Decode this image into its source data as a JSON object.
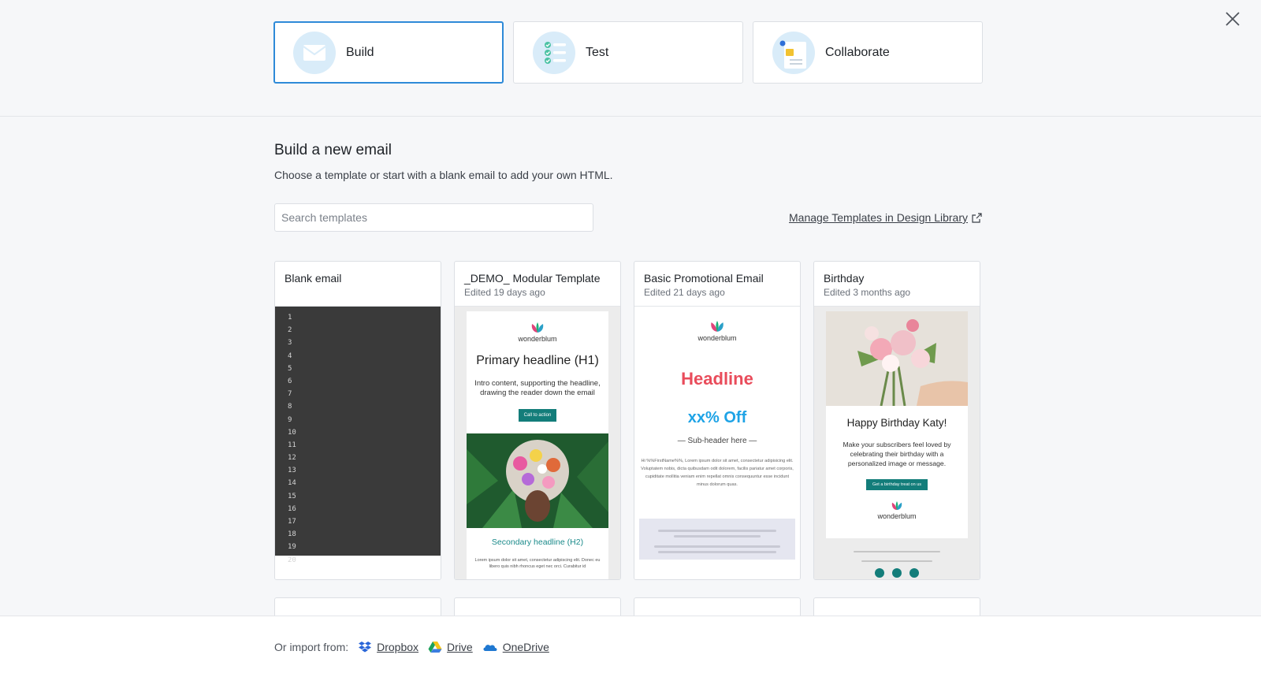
{
  "modes": [
    {
      "label": "Build",
      "icon": "envelope-icon"
    },
    {
      "label": "Test",
      "icon": "checklist-icon"
    },
    {
      "label": "Collaborate",
      "icon": "thumbs-up-note-icon"
    }
  ],
  "colors": {
    "accent": "#2e8ad8",
    "teal": "#137d7a",
    "headline_red": "#e94c5b",
    "offer_blue": "#1ea3e6"
  },
  "main": {
    "title": "Build a new email",
    "subtitle": "Choose a template or start with a blank email to add your own HTML.",
    "search_placeholder": "Search templates",
    "manage_link": "Manage Templates in Design Library"
  },
  "templates": [
    {
      "name": "Blank email",
      "meta": ""
    },
    {
      "name": "_DEMO_ Modular Template",
      "meta": "Edited 19 days ago"
    },
    {
      "name": "Basic Promotional Email",
      "meta": "Edited 21 days ago"
    },
    {
      "name": "Birthday",
      "meta": "Edited 3 months ago"
    }
  ],
  "line_numbers": [
    "1",
    "2",
    "3",
    "4",
    "5",
    "6",
    "7",
    "8",
    "9",
    "10",
    "11",
    "12",
    "13",
    "14",
    "15",
    "16",
    "17",
    "18",
    "19",
    "20"
  ],
  "demo_preview": {
    "brand": "wonderblum",
    "h1": "Primary headline (H1)",
    "intro": "Intro content, supporting the headline, drawing the reader down the email",
    "cta": "Call to action",
    "h2": "Secondary headline (H2)",
    "body": "Lorem ipsum dolor sit amet, consectetur adipiscing elit. Donec eu libero quis nibh rhoncus eget nec orci. Curabitur id"
  },
  "promo_preview": {
    "brand": "wonderblum",
    "headline": "Headline",
    "offer": "xx% Off",
    "subheader": "— Sub-header here —",
    "body": "Hi %%FirstName%%, Lorem ipsum dolor sit amet, consectetur adipisicing elit. Voluptatem nobis, dicta quibusdam odit dolorem, facilis pariatur amet corporis, cupiditate mollitia veniam enim repellat omnis consequuntur esse incidunt minus dolorum quas."
  },
  "birthday_preview": {
    "title": "Happy Birthday Katy!",
    "text": "Make your subscribers feel loved by celebrating their birthday with a personalized image or message.",
    "cta": "Get a birthday treat on us",
    "brand": "wonderblum"
  },
  "import": {
    "label": "Or import from:",
    "sources": [
      "Dropbox",
      "Drive",
      "OneDrive"
    ]
  }
}
